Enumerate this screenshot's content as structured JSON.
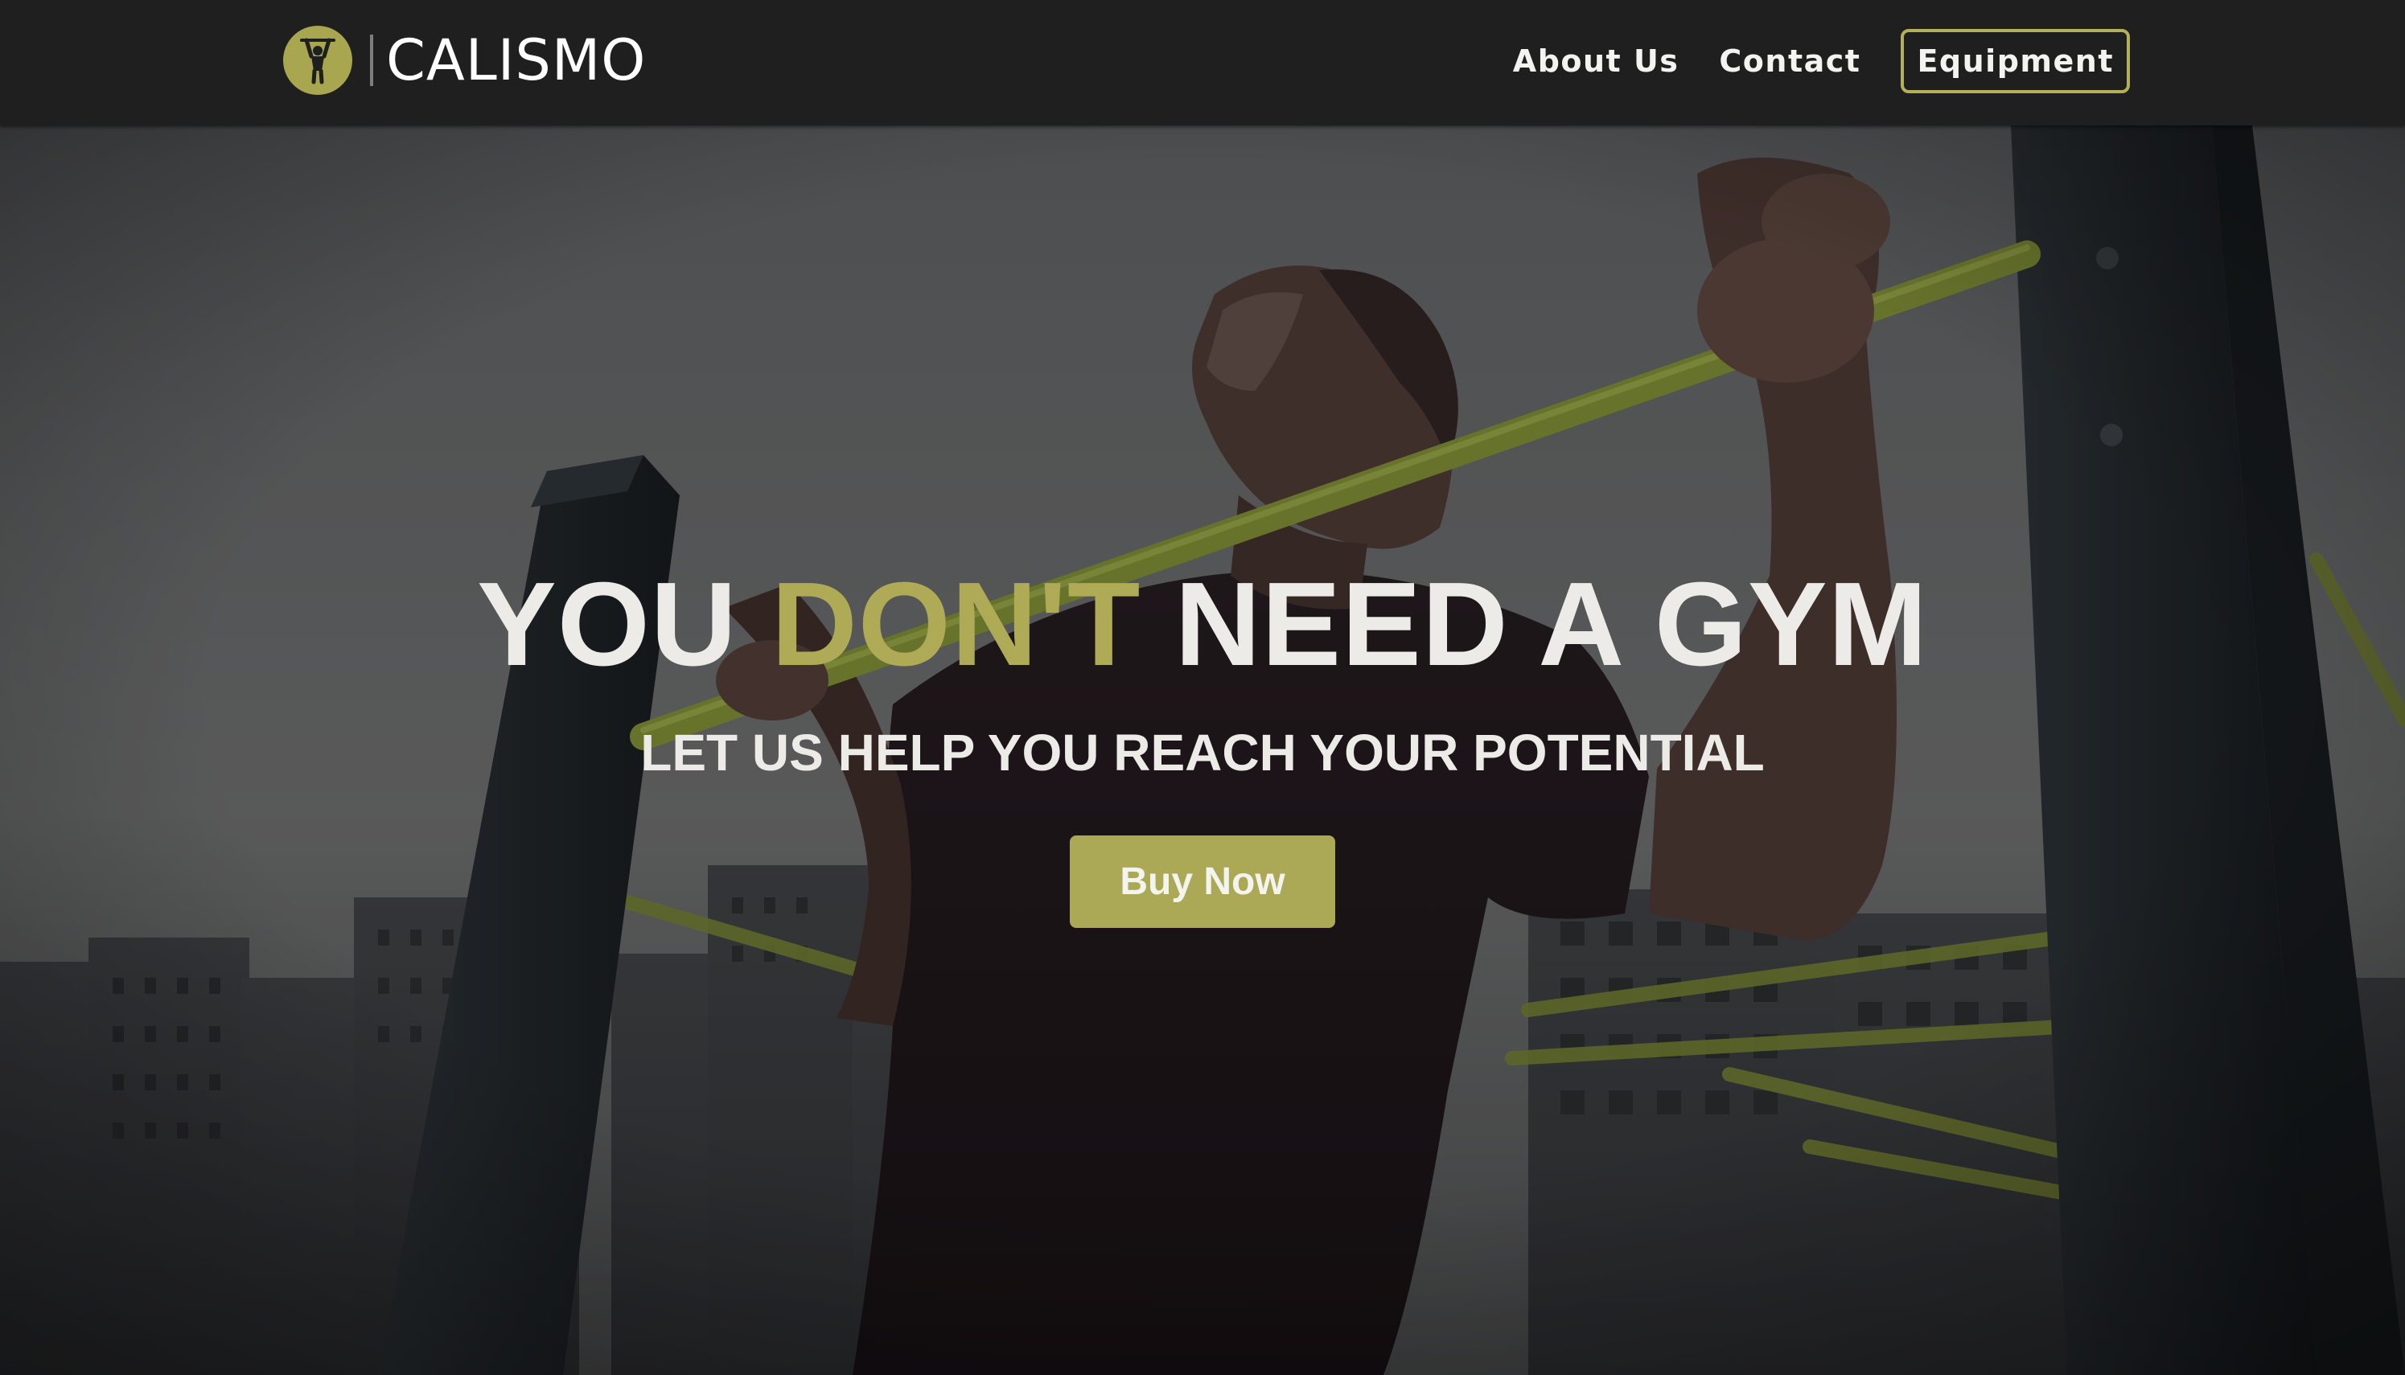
{
  "nav": {
    "logo_text": "CALISMO",
    "links": [
      {
        "label": "About Us"
      },
      {
        "label": "Contact"
      },
      {
        "label": "Equipment"
      }
    ]
  },
  "hero": {
    "headline_part1": "YOU ",
    "headline_accent": "DON'T",
    "headline_part2": " NEED A GYM",
    "subheadline": "LET US HELP YOU REACH YOUR POTENTIAL",
    "cta_label": "Buy Now"
  },
  "colors": {
    "navbar_bg": "#1e1f1e",
    "accent": "#aeaa55",
    "button_bg": "#aba955",
    "headline_text": "#ecebe7"
  },
  "icons": {
    "logo": "pullup-figure-icon"
  }
}
